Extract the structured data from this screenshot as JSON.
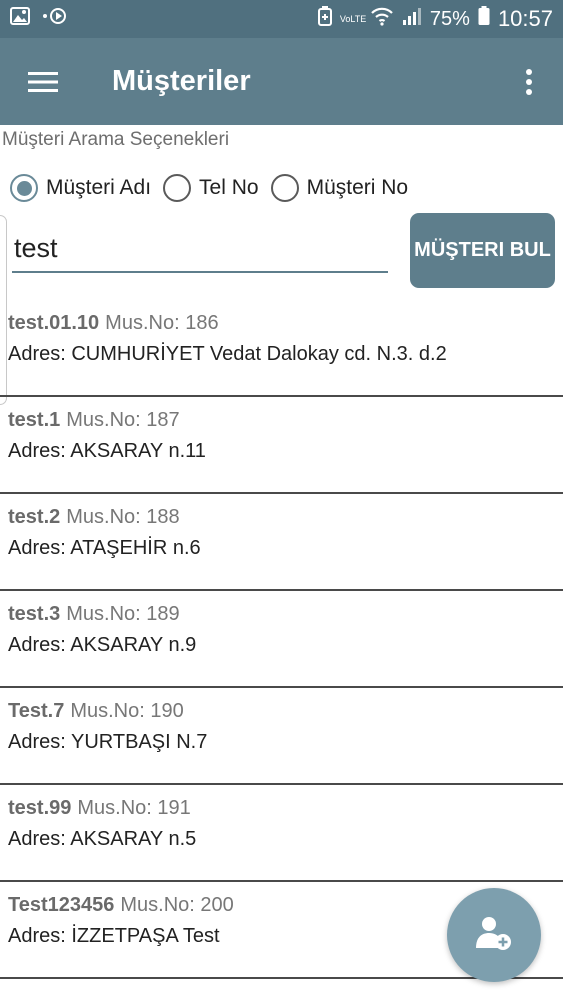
{
  "status_bar": {
    "icons_left": [
      "image-icon",
      "sync-icon"
    ],
    "icons_right": [
      "battery-saver-icon",
      "volte-icon",
      "wifi-icon",
      "signal-icon",
      "battery-icon"
    ],
    "volte_label": "VoLTE",
    "battery": "75%",
    "time": "10:57"
  },
  "app_bar": {
    "title": "Müşteriler",
    "menu_icon": "hamburger-menu-icon",
    "overflow_icon": "more-vertical-icon"
  },
  "search": {
    "options_label": "Müşteri Arama Seçenekleri",
    "options": [
      {
        "label": "Müşteri Adı",
        "checked": true
      },
      {
        "label": "Tel No",
        "checked": false
      },
      {
        "label": "Müşteri No",
        "checked": false
      }
    ],
    "query": "test",
    "find_button": "MÜŞTERI BUL"
  },
  "customers": [
    {
      "name": "test.01.10",
      "no": "Mus.No: 186",
      "address": "Adres: CUMHURİYET Vedat Dalokay cd. N.3. d.2"
    },
    {
      "name": "test.1",
      "no": "Mus.No: 187",
      "address": "Adres: AKSARAY n.11"
    },
    {
      "name": "test.2",
      "no": "Mus.No: 188",
      "address": "Adres: ATAŞEHİR n.6"
    },
    {
      "name": "test.3",
      "no": "Mus.No: 189",
      "address": "Adres: AKSARAY n.9"
    },
    {
      "name": "Test.7",
      "no": "Mus.No: 190",
      "address": "Adres: YURTBAŞI N.7"
    },
    {
      "name": "test.99",
      "no": "Mus.No: 191",
      "address": "Adres: AKSARAY n.5"
    },
    {
      "name": "Test123456",
      "no": "Mus.No: 200",
      "address": "Adres: İZZETPAŞA Test"
    }
  ],
  "fab": {
    "icon": "add-user-icon"
  },
  "colors": {
    "primary": "#5e7e8c",
    "status_bar": "#50707f",
    "fab": "#7d9fae",
    "accent_radio": "#6a8a98"
  }
}
